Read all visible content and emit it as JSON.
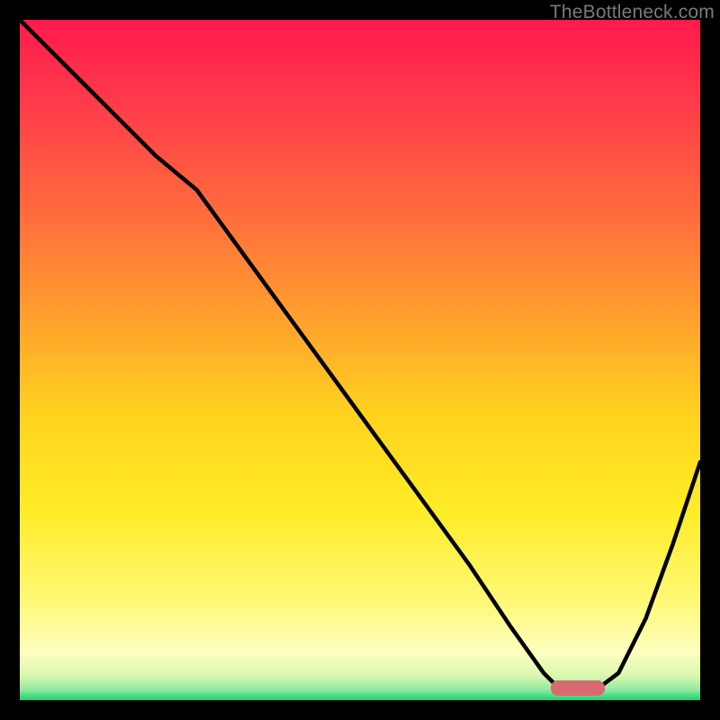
{
  "watermark": "TheBottleneck.com",
  "colors": {
    "gradient_stops": [
      {
        "y": 0.0,
        "c": "#ff1a4d"
      },
      {
        "y": 0.12,
        "c": "#ff3a4a"
      },
      {
        "y": 0.28,
        "c": "#ff6a3d"
      },
      {
        "y": 0.44,
        "c": "#ffa12e"
      },
      {
        "y": 0.58,
        "c": "#ffd21e"
      },
      {
        "y": 0.72,
        "c": "#ffec26"
      },
      {
        "y": 0.86,
        "c": "#fff97a"
      },
      {
        "y": 0.93,
        "c": "#fdffc0"
      },
      {
        "y": 0.965,
        "c": "#d8f7b0"
      },
      {
        "y": 0.985,
        "c": "#8deaa0"
      },
      {
        "y": 1.0,
        "c": "#17d070"
      }
    ],
    "curve": "#000000",
    "marker": "#d96a6f",
    "bg": "#000000"
  },
  "chart_data": {
    "type": "line",
    "title": "",
    "xlabel": "",
    "ylabel": "",
    "xlim": [
      0,
      100
    ],
    "ylim": [
      0,
      100
    ],
    "grid": false,
    "legend": false,
    "series": [
      {
        "name": "bottleneck-curve",
        "x": [
          0,
          10,
          20,
          26,
          34,
          42,
          50,
          58,
          66,
          72,
          77,
          80,
          84,
          88,
          92,
          96,
          100
        ],
        "y": [
          100,
          90,
          80,
          75,
          64,
          53,
          42,
          31,
          20,
          11,
          4,
          1,
          1,
          4,
          12,
          23,
          35
        ]
      }
    ],
    "annotations": [
      {
        "type": "marker-bar",
        "x_start": 78,
        "x_end": 86,
        "y": 0.7,
        "height": 2.2
      }
    ]
  }
}
